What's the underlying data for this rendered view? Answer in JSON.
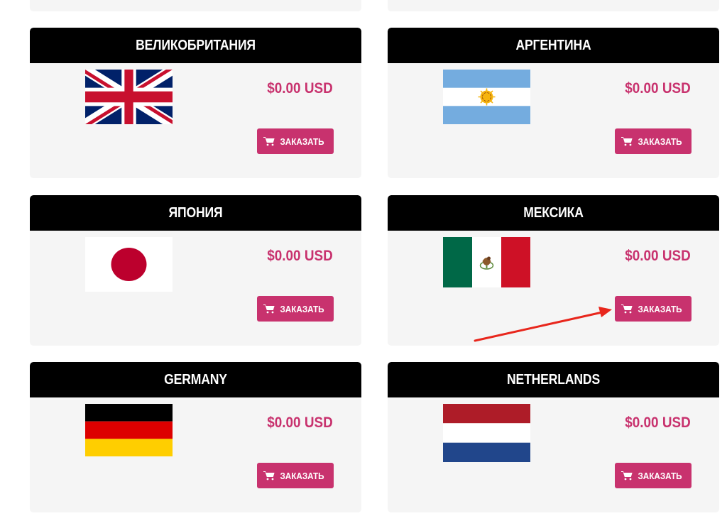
{
  "colors": {
    "accent": "#c8326e",
    "header_bg": "#000000",
    "card_bg": "#f5f5f5",
    "annotation_arrow": "#e8261c"
  },
  "cards": [
    {
      "title": "ВЕЛИКОБРИТАНИЯ",
      "price": "$0.00 USD",
      "button": "ЗАКАЗАТЬ",
      "flag": "uk-flag"
    },
    {
      "title": "АРГЕНТИНА",
      "price": "$0.00 USD",
      "button": "ЗАКАЗАТЬ",
      "flag": "argentina-flag"
    },
    {
      "title": "ЯПОНИЯ",
      "price": "$0.00 USD",
      "button": "ЗАКАЗАТЬ",
      "flag": "japan-flag"
    },
    {
      "title": "МЕКСИКА",
      "price": "$0.00 USD",
      "button": "ЗАКАЗАТЬ",
      "flag": "mexico-flag"
    },
    {
      "title": "GERMANY",
      "price": "$0.00 USD",
      "button": "ЗАКАЗАТЬ",
      "flag": "germany-flag"
    },
    {
      "title": "NETHERLANDS",
      "price": "$0.00 USD",
      "button": "ЗАКАЗАТЬ",
      "flag": "netherlands-flag"
    }
  ],
  "icons": {
    "button_icon": "cart-icon"
  }
}
